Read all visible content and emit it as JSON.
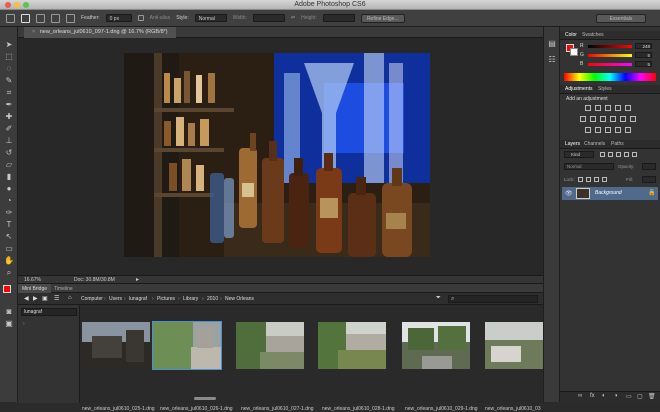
{
  "app": {
    "title": "Adobe Photoshop CS6"
  },
  "options": {
    "feather_label": "Feather:",
    "feather_value": "0 px",
    "antialias_label": "Anti-alias",
    "style_label": "Style:",
    "style_value": "Normal",
    "width_label": "Width:",
    "height_label": "Height:",
    "refine_label": "Refine Edge...",
    "workspace": "Essentials"
  },
  "document": {
    "tab_title": "new_orleans_jul0610_097-1.dng @ 16.7% (RGB/8*)",
    "zoom": "16.67%",
    "doc_size": "Doc: 30.8M/30.8M"
  },
  "bridge": {
    "tabs": [
      "Mini Bridge",
      "Timeline"
    ],
    "breadcrumbs": [
      "Computer",
      "Users",
      "lunagraf",
      "Pictures",
      "Library",
      "2010",
      "New Orleans"
    ],
    "folder": "lunagraf",
    "thumbnails": [
      {
        "label": "new_orleans_jul0610_025-1.dng"
      },
      {
        "label": "new_orleans_jul0610_026-1.dng"
      },
      {
        "label": "new_orleans_jul0610_027-1.dng"
      },
      {
        "label": "new_orleans_jul0610_028-1.dng"
      },
      {
        "label": "new_orleans_jul0610_029-1.dng"
      },
      {
        "label": "new_orleans_jul0610_03"
      }
    ]
  },
  "color_panel": {
    "tabs": [
      "Color",
      "Swatches"
    ],
    "channels": [
      {
        "label": "R",
        "value": "248"
      },
      {
        "label": "G",
        "value": "5"
      },
      {
        "label": "B",
        "value": "5"
      }
    ]
  },
  "adjustments_panel": {
    "tabs": [
      "Adjustments",
      "Styles"
    ],
    "heading": "Add an adjustment"
  },
  "layers_panel": {
    "tabs": [
      "Layers",
      "Channels",
      "Paths"
    ],
    "kind_label": "Kind",
    "blend_mode": "Normal",
    "opacity_label": "Opacity:",
    "lock_label": "Lock:",
    "fill_label": "Fill:",
    "layers": [
      {
        "name": "Background"
      }
    ]
  },
  "colors": {
    "accent": "#4b8fd6",
    "foreground_swatch": "#f80505",
    "layer_selected": "#506a8c"
  }
}
